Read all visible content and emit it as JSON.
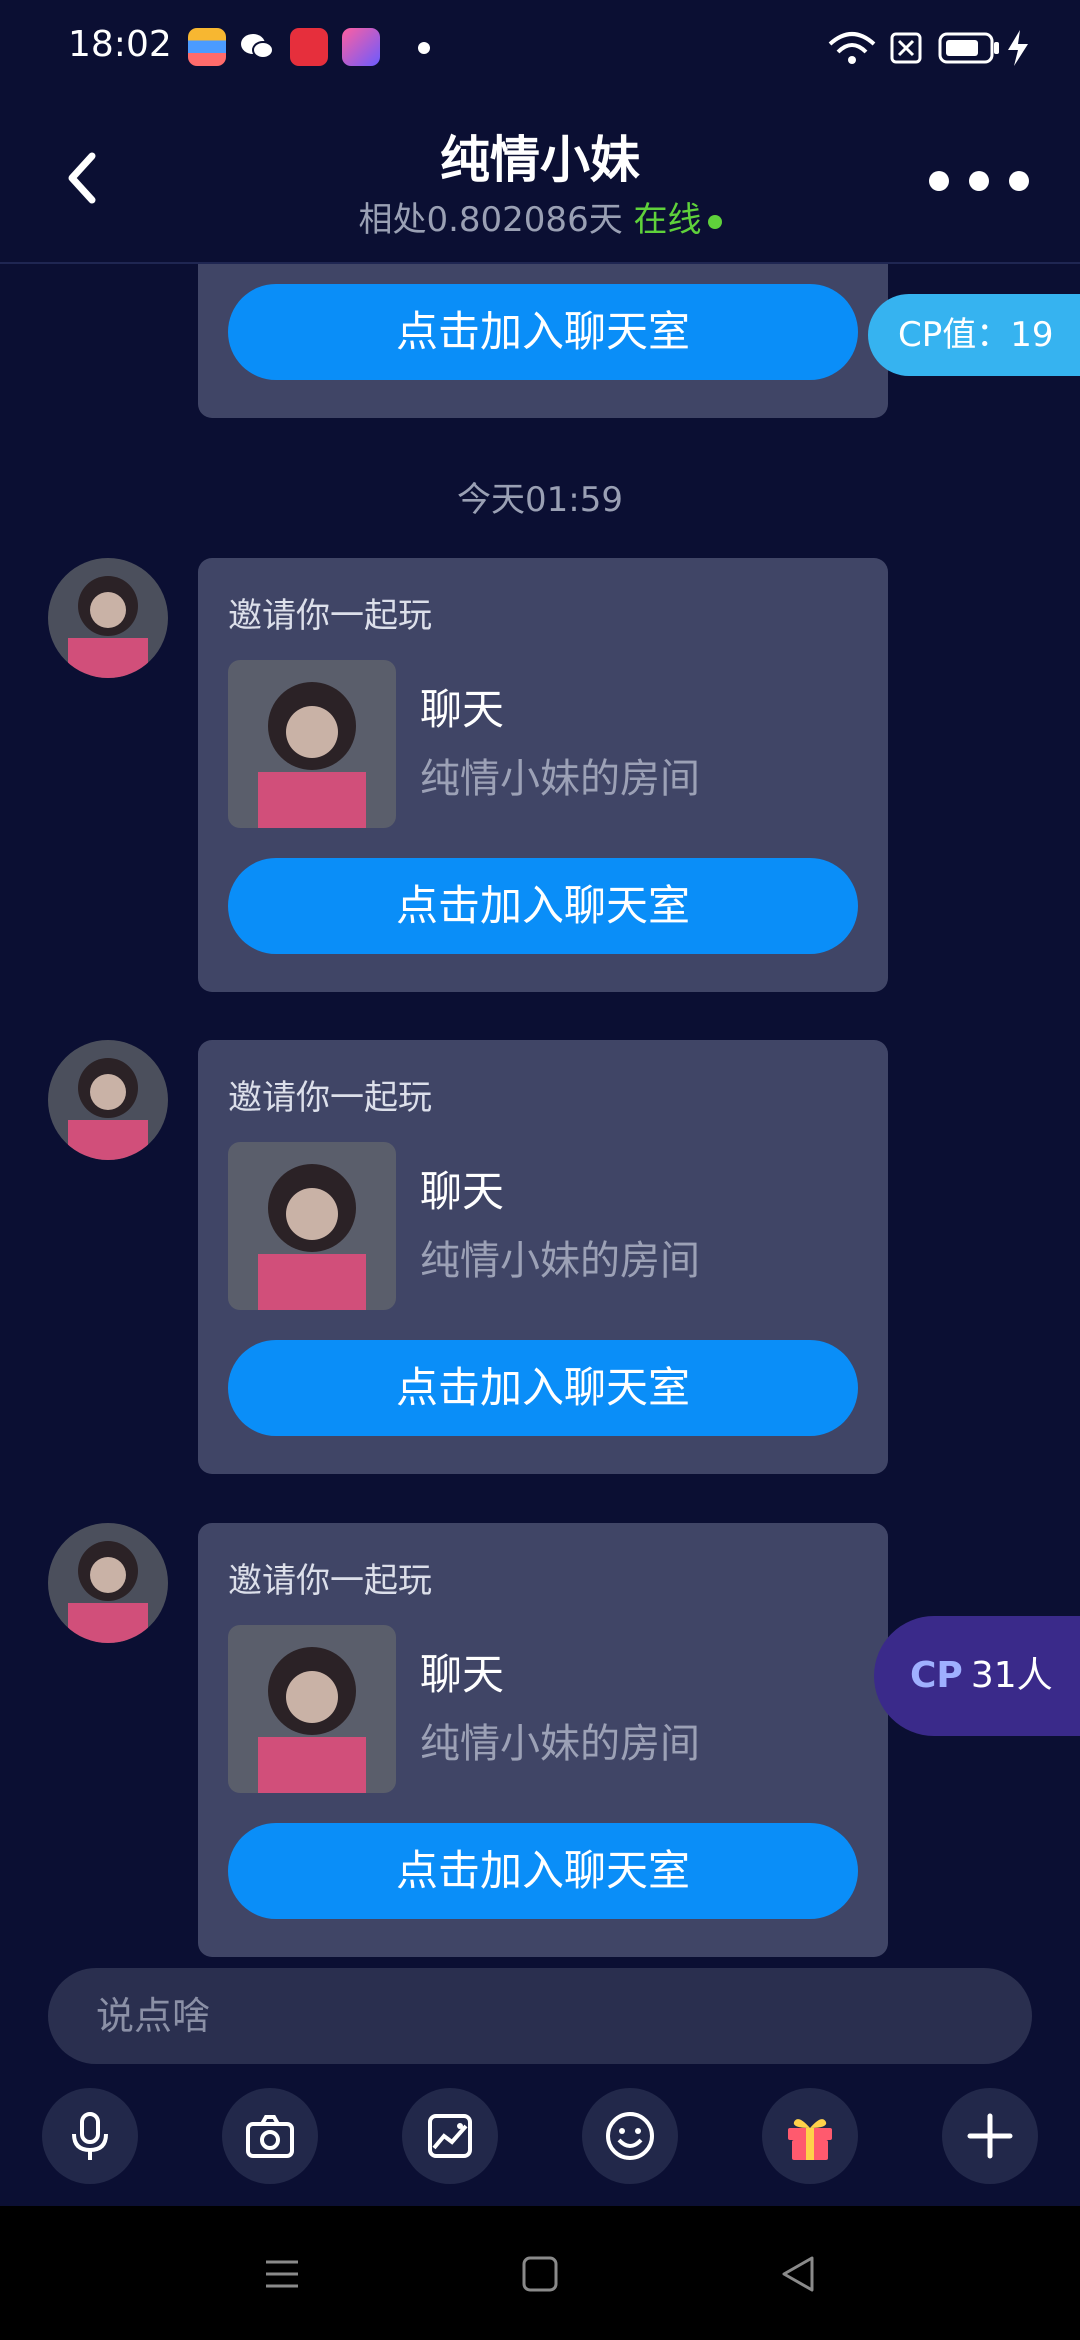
{
  "status_bar": {
    "time": "18:02"
  },
  "header": {
    "title": "纯情小妹",
    "subtitle_prefix": "相处0.802086天",
    "online_label": "在线"
  },
  "cp_badge": {
    "label": "CP值：19"
  },
  "cp_people": {
    "prefix": "CP",
    "count": "31人"
  },
  "timestamp": "今天01:59",
  "partial_card": {
    "button": "点击加入聊天室"
  },
  "messages": [
    {
      "title": "邀请你一起玩",
      "room_name": "聊天",
      "room_sub": "纯情小妹的房间",
      "button": "点击加入聊天室"
    },
    {
      "title": "邀请你一起玩",
      "room_name": "聊天",
      "room_sub": "纯情小妹的房间",
      "button": "点击加入聊天室"
    },
    {
      "title": "邀请你一起玩",
      "room_name": "聊天",
      "room_sub": "纯情小妹的房间",
      "button": "点击加入聊天室"
    }
  ],
  "input": {
    "placeholder": "说点啥"
  },
  "toolbar": [
    "mic-icon",
    "camera-icon",
    "image-icon",
    "emoji-icon",
    "gift-icon",
    "plus-icon"
  ],
  "colors": {
    "background": "#0b0f33",
    "card": "#404566",
    "button": "#0a8ef8",
    "online": "#5fd13b",
    "cp_pill": "#36b3f0",
    "cp_people": "#3a2a8a"
  }
}
